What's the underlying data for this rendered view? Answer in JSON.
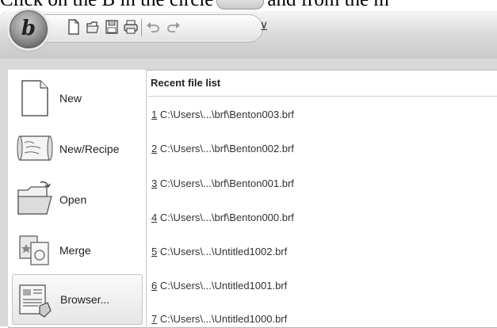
{
  "instruction": {
    "before": "Click on the B in the circle",
    "after": "and from the m"
  },
  "app_button": {
    "letter": "b"
  },
  "quick_access_toolbar": {
    "icons": [
      "new-doc-icon",
      "open-folder-icon",
      "save-icon",
      "print-icon",
      "undo-icon",
      "redo-icon"
    ],
    "dropdown_glyph": "⊻"
  },
  "menu": {
    "left_items": [
      {
        "label": "New",
        "icon": "new-document-icon",
        "selected": false
      },
      {
        "label": "New/Recipe",
        "icon": "recipe-scroll-icon",
        "selected": false
      },
      {
        "label": "Open",
        "icon": "open-folder-icon",
        "selected": false
      },
      {
        "label": "Merge",
        "icon": "merge-icon",
        "selected": false
      },
      {
        "label": "Browser...",
        "icon": "browser-icon",
        "selected": true
      }
    ],
    "recent": {
      "header": "Recent file list",
      "items": [
        {
          "num": "1",
          "path": " C:\\Users\\...\\brf\\Benton003.brf"
        },
        {
          "num": "2",
          "path": " C:\\Users\\...\\brf\\Benton002.brf"
        },
        {
          "num": "3",
          "path": " C:\\Users\\...\\brf\\Benton001.brf"
        },
        {
          "num": "4",
          "path": " C:\\Users\\...\\brf\\Benton000.brf"
        },
        {
          "num": "5",
          "path": " C:\\Users\\...\\Untitled1002.brf"
        },
        {
          "num": "6",
          "path": " C:\\Users\\...\\Untitled1001.brf"
        },
        {
          "num": "7",
          "path": " C:\\Users\\...\\Untitled1000.brf"
        }
      ]
    }
  }
}
